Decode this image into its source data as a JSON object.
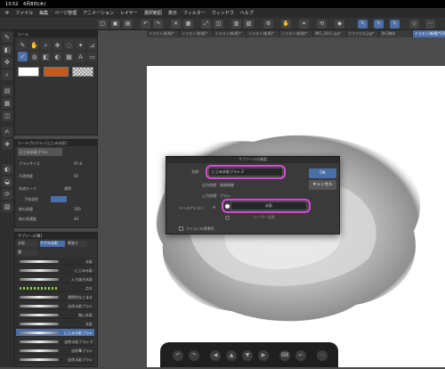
{
  "status": {
    "time": "13:52",
    "date": "4月8日(木)"
  },
  "menu": [
    "ファイル",
    "編集",
    "ページ管理",
    "アニメーション",
    "レイヤー",
    "選択範囲",
    "表示",
    "フィルター",
    "ウィンドウ",
    "ヘルプ"
  ],
  "tabs": [
    "イラスト(新規)*",
    "イラスト(新規)*",
    "イラスト(新規)*",
    "イラスト(新規)*",
    "イラスト(新規)*",
    "IMG_1841.jpg*",
    "カラフル文.jpg*",
    "飛行機体",
    "イラスト(新規)*(2048×2048)"
  ],
  "tool_panel": {
    "title": "ツール"
  },
  "tool_property": {
    "title": "ツールプロパティ[にじみ水彩]",
    "brush": "にじみ水彩ブラシ",
    "rows": [
      {
        "label": "ブラシサイズ",
        "value": "97.8"
      },
      {
        "label": "不透明度",
        "value": "92"
      },
      {
        "label": "合成モード",
        "value": "通常"
      },
      {
        "label": "下地混色",
        "value": ""
      },
      {
        "label": "絵の具量",
        "value": "100"
      },
      {
        "label": "絵の具濃度",
        "value": "44"
      }
    ]
  },
  "subtool_panel": {
    "title": "サブツール[筆]",
    "tabs": [
      "水彩",
      "リアル水彩",
      "厚塗り"
    ],
    "group": "墨"
  },
  "brushes": [
    {
      "name": "水彩"
    },
    {
      "name": "にじみ水彩"
    },
    {
      "name": "入り抜き水彩"
    },
    {
      "name": "点々"
    },
    {
      "name": "透明色なじませ"
    },
    {
      "name": "自作水彩ブラシ"
    },
    {
      "name": "鈍い水彩"
    },
    {
      "name": "水彩"
    },
    {
      "name": "にじみ水彩ブラシ"
    },
    {
      "name": "自作水彩ブラシ 2"
    },
    {
      "name": "自作筆ブラシ"
    },
    {
      "name": "自作水彩ブラシ"
    }
  ],
  "dialog": {
    "title": "サブツールの複製",
    "name_label": "名前：",
    "name_value": "にじみ水彩ブラシ 2",
    "output_label": "出力処理：描画制御",
    "input_label": "入力処理：ブラシ",
    "icon_label": "ツールアイコン：",
    "icon_value": "水彩",
    "user_icon": "ユーザー画像",
    "bg_checkbox": "アイコンの背景色",
    "ok": "OK",
    "cancel": "キャンセル"
  },
  "colors": {
    "accent": "#4a6ea8",
    "highlight": "#d44bd8",
    "swatch_orange": "#c8571a"
  }
}
